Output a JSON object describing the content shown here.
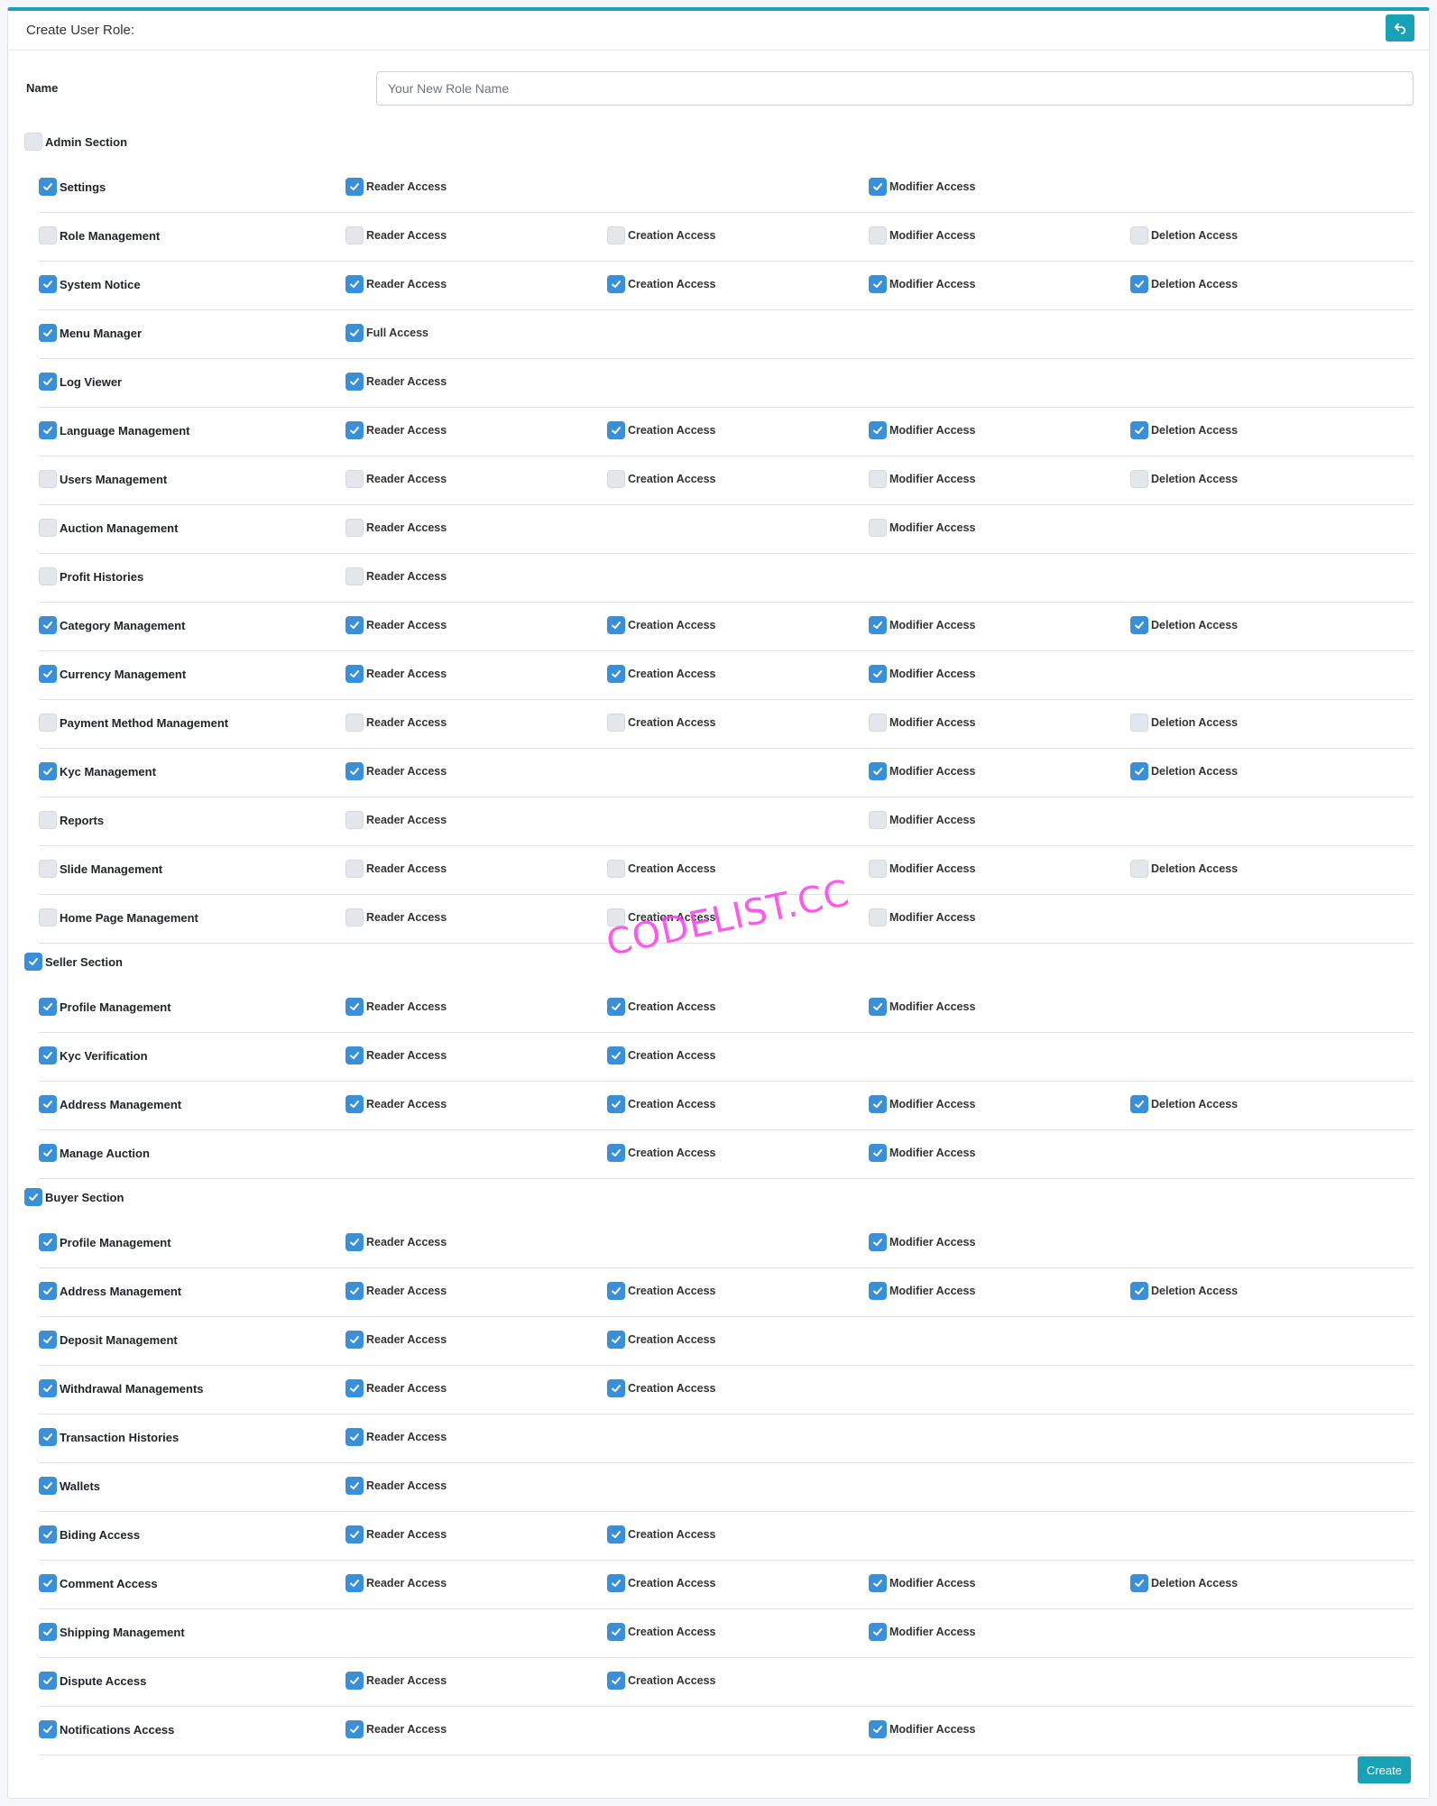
{
  "header": {
    "title": "Create User Role:",
    "back_icon": "undo-icon"
  },
  "form": {
    "name_label": "Name",
    "name_placeholder": "Your New Role Name",
    "name_value": ""
  },
  "sections": [
    {
      "title": "Admin Section",
      "checked": false,
      "items": [
        {
          "label": "Settings",
          "checked": true,
          "perms": [
            {
              "label": "Reader Access",
              "checked": true
            },
            {
              "label": "Modifier Access",
              "checked": true
            }
          ]
        },
        {
          "label": "Role Management",
          "checked": false,
          "perms": [
            {
              "label": "Reader Access",
              "checked": false
            },
            {
              "label": "Creation Access",
              "checked": false
            },
            {
              "label": "Modifier Access",
              "checked": false
            },
            {
              "label": "Deletion Access",
              "checked": false
            }
          ]
        },
        {
          "label": "System Notice",
          "checked": true,
          "perms": [
            {
              "label": "Reader Access",
              "checked": true
            },
            {
              "label": "Creation Access",
              "checked": true
            },
            {
              "label": "Modifier Access",
              "checked": true
            },
            {
              "label": "Deletion Access",
              "checked": true
            }
          ]
        },
        {
          "label": "Menu Manager",
          "checked": true,
          "perms": [
            {
              "label": "Full Access",
              "checked": true
            }
          ]
        },
        {
          "label": "Log Viewer",
          "checked": true,
          "perms": [
            {
              "label": "Reader Access",
              "checked": true
            }
          ]
        },
        {
          "label": "Language Management",
          "checked": true,
          "perms": [
            {
              "label": "Reader Access",
              "checked": true
            },
            {
              "label": "Creation Access",
              "checked": true
            },
            {
              "label": "Modifier Access",
              "checked": true
            },
            {
              "label": "Deletion Access",
              "checked": true
            }
          ]
        },
        {
          "label": "Users Management",
          "checked": false,
          "perms": [
            {
              "label": "Reader Access",
              "checked": false
            },
            {
              "label": "Creation Access",
              "checked": false
            },
            {
              "label": "Modifier Access",
              "checked": false
            },
            {
              "label": "Deletion Access",
              "checked": false
            }
          ]
        },
        {
          "label": "Auction Management",
          "checked": false,
          "perms": [
            {
              "label": "Reader Access",
              "checked": false
            },
            {
              "label": "Modifier Access",
              "checked": false
            }
          ]
        },
        {
          "label": "Profit Histories",
          "checked": false,
          "perms": [
            {
              "label": "Reader Access",
              "checked": false
            }
          ]
        },
        {
          "label": "Category Management",
          "checked": true,
          "perms": [
            {
              "label": "Reader Access",
              "checked": true
            },
            {
              "label": "Creation Access",
              "checked": true
            },
            {
              "label": "Modifier Access",
              "checked": true
            },
            {
              "label": "Deletion Access",
              "checked": true
            }
          ]
        },
        {
          "label": "Currency Management",
          "checked": true,
          "perms": [
            {
              "label": "Reader Access",
              "checked": true
            },
            {
              "label": "Creation Access",
              "checked": true
            },
            {
              "label": "Modifier Access",
              "checked": true
            }
          ]
        },
        {
          "label": "Payment Method Management",
          "checked": false,
          "perms": [
            {
              "label": "Reader Access",
              "checked": false
            },
            {
              "label": "Creation Access",
              "checked": false
            },
            {
              "label": "Modifier Access",
              "checked": false
            },
            {
              "label": "Deletion Access",
              "checked": false
            }
          ]
        },
        {
          "label": "Kyc Management",
          "checked": true,
          "perms": [
            {
              "label": "Reader Access",
              "checked": true
            },
            {
              "label": "Modifier Access",
              "checked": true
            },
            {
              "label": "Deletion Access",
              "checked": true
            }
          ]
        },
        {
          "label": "Reports",
          "checked": false,
          "perms": [
            {
              "label": "Reader Access",
              "checked": false
            },
            {
              "label": "Modifier Access",
              "checked": false
            }
          ]
        },
        {
          "label": "Slide Management",
          "checked": false,
          "perms": [
            {
              "label": "Reader Access",
              "checked": false
            },
            {
              "label": "Creation Access",
              "checked": false
            },
            {
              "label": "Modifier Access",
              "checked": false
            },
            {
              "label": "Deletion Access",
              "checked": false
            }
          ]
        },
        {
          "label": "Home Page Management",
          "checked": false,
          "perms": [
            {
              "label": "Reader Access",
              "checked": false
            },
            {
              "label": "Creation Access",
              "checked": false
            },
            {
              "label": "Modifier Access",
              "checked": false
            }
          ]
        }
      ]
    },
    {
      "title": "Seller Section",
      "checked": true,
      "items": [
        {
          "label": "Profile Management",
          "checked": true,
          "perms": [
            {
              "label": "Reader Access",
              "checked": true
            },
            {
              "label": "Creation Access",
              "checked": true
            },
            {
              "label": "Modifier Access",
              "checked": true
            }
          ]
        },
        {
          "label": "Kyc Verification",
          "checked": true,
          "perms": [
            {
              "label": "Reader Access",
              "checked": true
            },
            {
              "label": "Creation Access",
              "checked": true
            }
          ]
        },
        {
          "label": "Address Management",
          "checked": true,
          "perms": [
            {
              "label": "Reader Access",
              "checked": true
            },
            {
              "label": "Creation Access",
              "checked": true
            },
            {
              "label": "Modifier Access",
              "checked": true
            },
            {
              "label": "Deletion Access",
              "checked": true
            }
          ]
        },
        {
          "label": "Manage Auction",
          "checked": true,
          "perms": [
            {
              "label": "Creation Access",
              "checked": true
            },
            {
              "label": "Modifier Access",
              "checked": true
            }
          ]
        }
      ]
    },
    {
      "title": "Buyer Section",
      "checked": true,
      "items": [
        {
          "label": "Profile Management",
          "checked": true,
          "perms": [
            {
              "label": "Reader Access",
              "checked": true
            },
            {
              "label": "Modifier Access",
              "checked": true
            }
          ]
        },
        {
          "label": "Address Management",
          "checked": true,
          "perms": [
            {
              "label": "Reader Access",
              "checked": true
            },
            {
              "label": "Creation Access",
              "checked": true
            },
            {
              "label": "Modifier Access",
              "checked": true
            },
            {
              "label": "Deletion Access",
              "checked": true
            }
          ]
        },
        {
          "label": "Deposit Management",
          "checked": true,
          "perms": [
            {
              "label": "Reader Access",
              "checked": true
            },
            {
              "label": "Creation Access",
              "checked": true
            }
          ]
        },
        {
          "label": "Withdrawal Managements",
          "checked": true,
          "perms": [
            {
              "label": "Reader Access",
              "checked": true
            },
            {
              "label": "Creation Access",
              "checked": true
            }
          ]
        },
        {
          "label": "Transaction Histories",
          "checked": true,
          "perms": [
            {
              "label": "Reader Access",
              "checked": true
            }
          ]
        },
        {
          "label": "Wallets",
          "checked": true,
          "perms": [
            {
              "label": "Reader Access",
              "checked": true
            }
          ]
        },
        {
          "label": "Biding Access",
          "checked": true,
          "perms": [
            {
              "label": "Reader Access",
              "checked": true
            },
            {
              "label": "Creation Access",
              "checked": true
            }
          ]
        },
        {
          "label": "Comment Access",
          "checked": true,
          "perms": [
            {
              "label": "Reader Access",
              "checked": true
            },
            {
              "label": "Creation Access",
              "checked": true
            },
            {
              "label": "Modifier Access",
              "checked": true
            },
            {
              "label": "Deletion Access",
              "checked": true
            }
          ]
        },
        {
          "label": "Shipping Management",
          "checked": true,
          "perms": [
            {
              "label": "Creation Access",
              "checked": true
            },
            {
              "label": "Modifier Access",
              "checked": true
            }
          ]
        },
        {
          "label": "Dispute Access",
          "checked": true,
          "perms": [
            {
              "label": "Reader Access",
              "checked": true
            },
            {
              "label": "Creation Access",
              "checked": true
            }
          ]
        },
        {
          "label": "Notifications Access",
          "checked": true,
          "perms": [
            {
              "label": "Reader Access",
              "checked": true
            },
            {
              "label": "Modifier Access",
              "checked": true
            }
          ]
        }
      ]
    }
  ],
  "actions": {
    "create_label": "Create"
  },
  "watermark": "CODELIST.CC",
  "colors": {
    "accent": "#17a2b8",
    "checkbox_on": "#3a8fd9",
    "checkbox_off": "#e3e6ea"
  }
}
